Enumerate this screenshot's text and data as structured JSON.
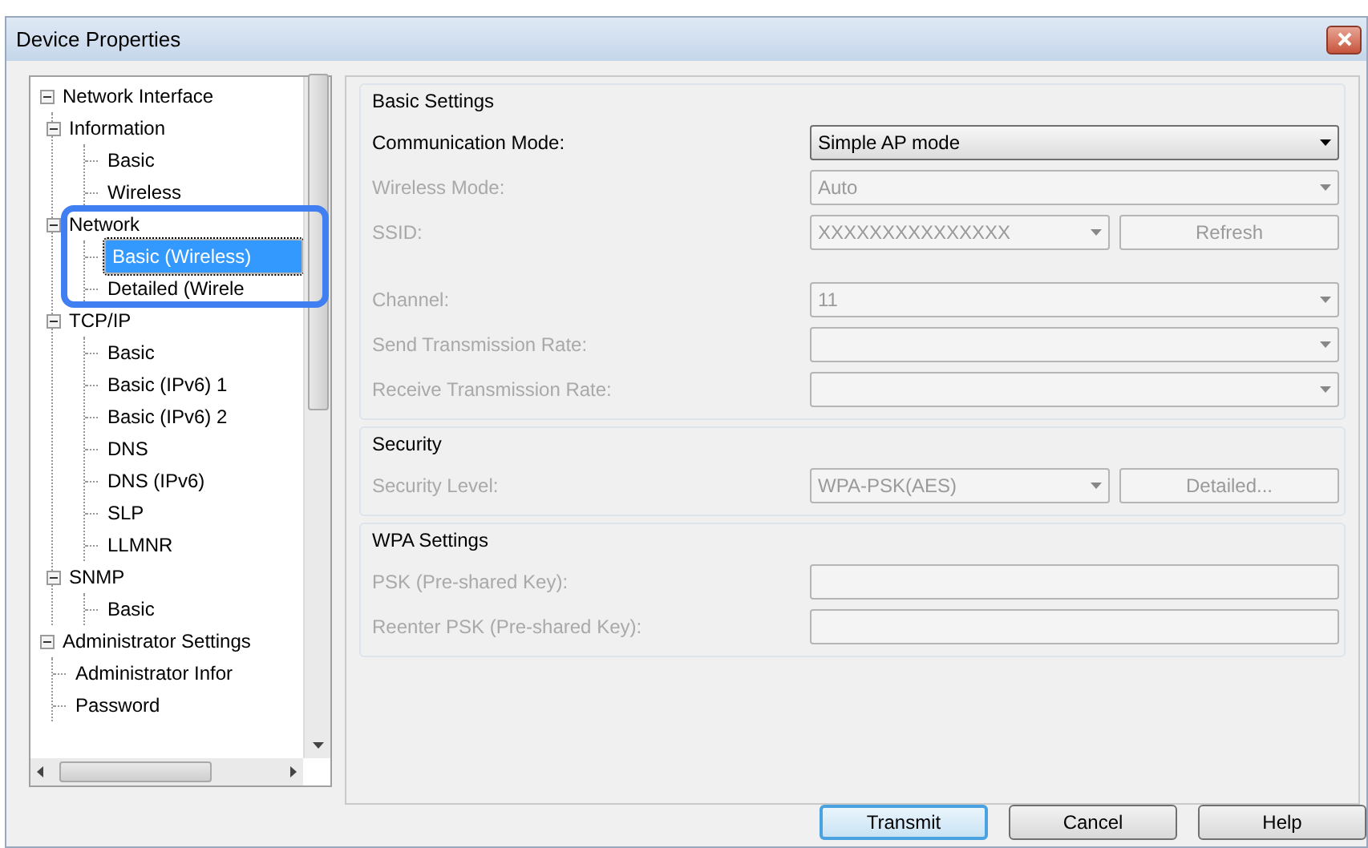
{
  "window": {
    "title": "Device Properties"
  },
  "tree": [
    {
      "label": "Network Interface",
      "expanded": true,
      "selected": false,
      "children": [
        {
          "label": "Information",
          "expanded": true,
          "selected": false,
          "children": [
            {
              "label": "Basic",
              "selected": false
            },
            {
              "label": "Wireless",
              "selected": false
            }
          ]
        },
        {
          "label": "Network",
          "expanded": true,
          "selected": false,
          "children": [
            {
              "label": "Basic (Wireless)",
              "selected": true
            },
            {
              "label": "Detailed (Wirele",
              "selected": false
            }
          ]
        },
        {
          "label": "TCP/IP",
          "expanded": true,
          "selected": false,
          "children": [
            {
              "label": "Basic",
              "selected": false
            },
            {
              "label": "Basic (IPv6) 1",
              "selected": false
            },
            {
              "label": "Basic (IPv6) 2",
              "selected": false
            },
            {
              "label": "DNS",
              "selected": false
            },
            {
              "label": "DNS (IPv6)",
              "selected": false
            },
            {
              "label": "SLP",
              "selected": false
            },
            {
              "label": "LLMNR",
              "selected": false
            }
          ]
        },
        {
          "label": "SNMP",
          "expanded": true,
          "selected": false,
          "children": [
            {
              "label": "Basic",
              "selected": false
            }
          ]
        }
      ]
    },
    {
      "label": "Administrator Settings",
      "expanded": true,
      "selected": false,
      "children": [
        {
          "label": "Administrator Infor",
          "selected": false
        },
        {
          "label": "Password",
          "selected": false
        }
      ]
    }
  ],
  "groups": [
    {
      "title": "Basic Settings",
      "fields": [
        {
          "label": "Communication Mode:",
          "kind": "select",
          "value": "Simple AP mode",
          "disabled": false
        },
        {
          "label": "Wireless Mode:",
          "kind": "select",
          "value": "Auto",
          "disabled": true
        },
        {
          "label": "SSID:",
          "kind": "combo",
          "value": "XXXXXXXXXXXXXXX",
          "button": "Refresh",
          "disabled": true
        },
        {
          "label": "Channel:",
          "kind": "select",
          "value": "11",
          "disabled": true
        },
        {
          "label": "Send Transmission Rate:",
          "kind": "select",
          "disabled": true
        },
        {
          "label": "Receive Transmission Rate:",
          "kind": "select",
          "disabled": true
        }
      ]
    },
    {
      "title": "Security",
      "fields": [
        {
          "label": "Security Level:",
          "kind": "combo",
          "value": "WPA-PSK(AES)",
          "button": "Detailed...",
          "disabled": true
        }
      ]
    },
    {
      "title": "WPA Settings",
      "fields": [
        {
          "label": "PSK (Pre-shared Key):",
          "kind": "input",
          "disabled": true
        },
        {
          "label": "Reenter PSK (Pre-shared Key):",
          "kind": "input",
          "disabled": true
        }
      ]
    }
  ],
  "buttons": [
    {
      "label": "Transmit",
      "default": true
    },
    {
      "label": "Cancel",
      "default": false
    },
    {
      "label": "Help",
      "default": false
    }
  ]
}
